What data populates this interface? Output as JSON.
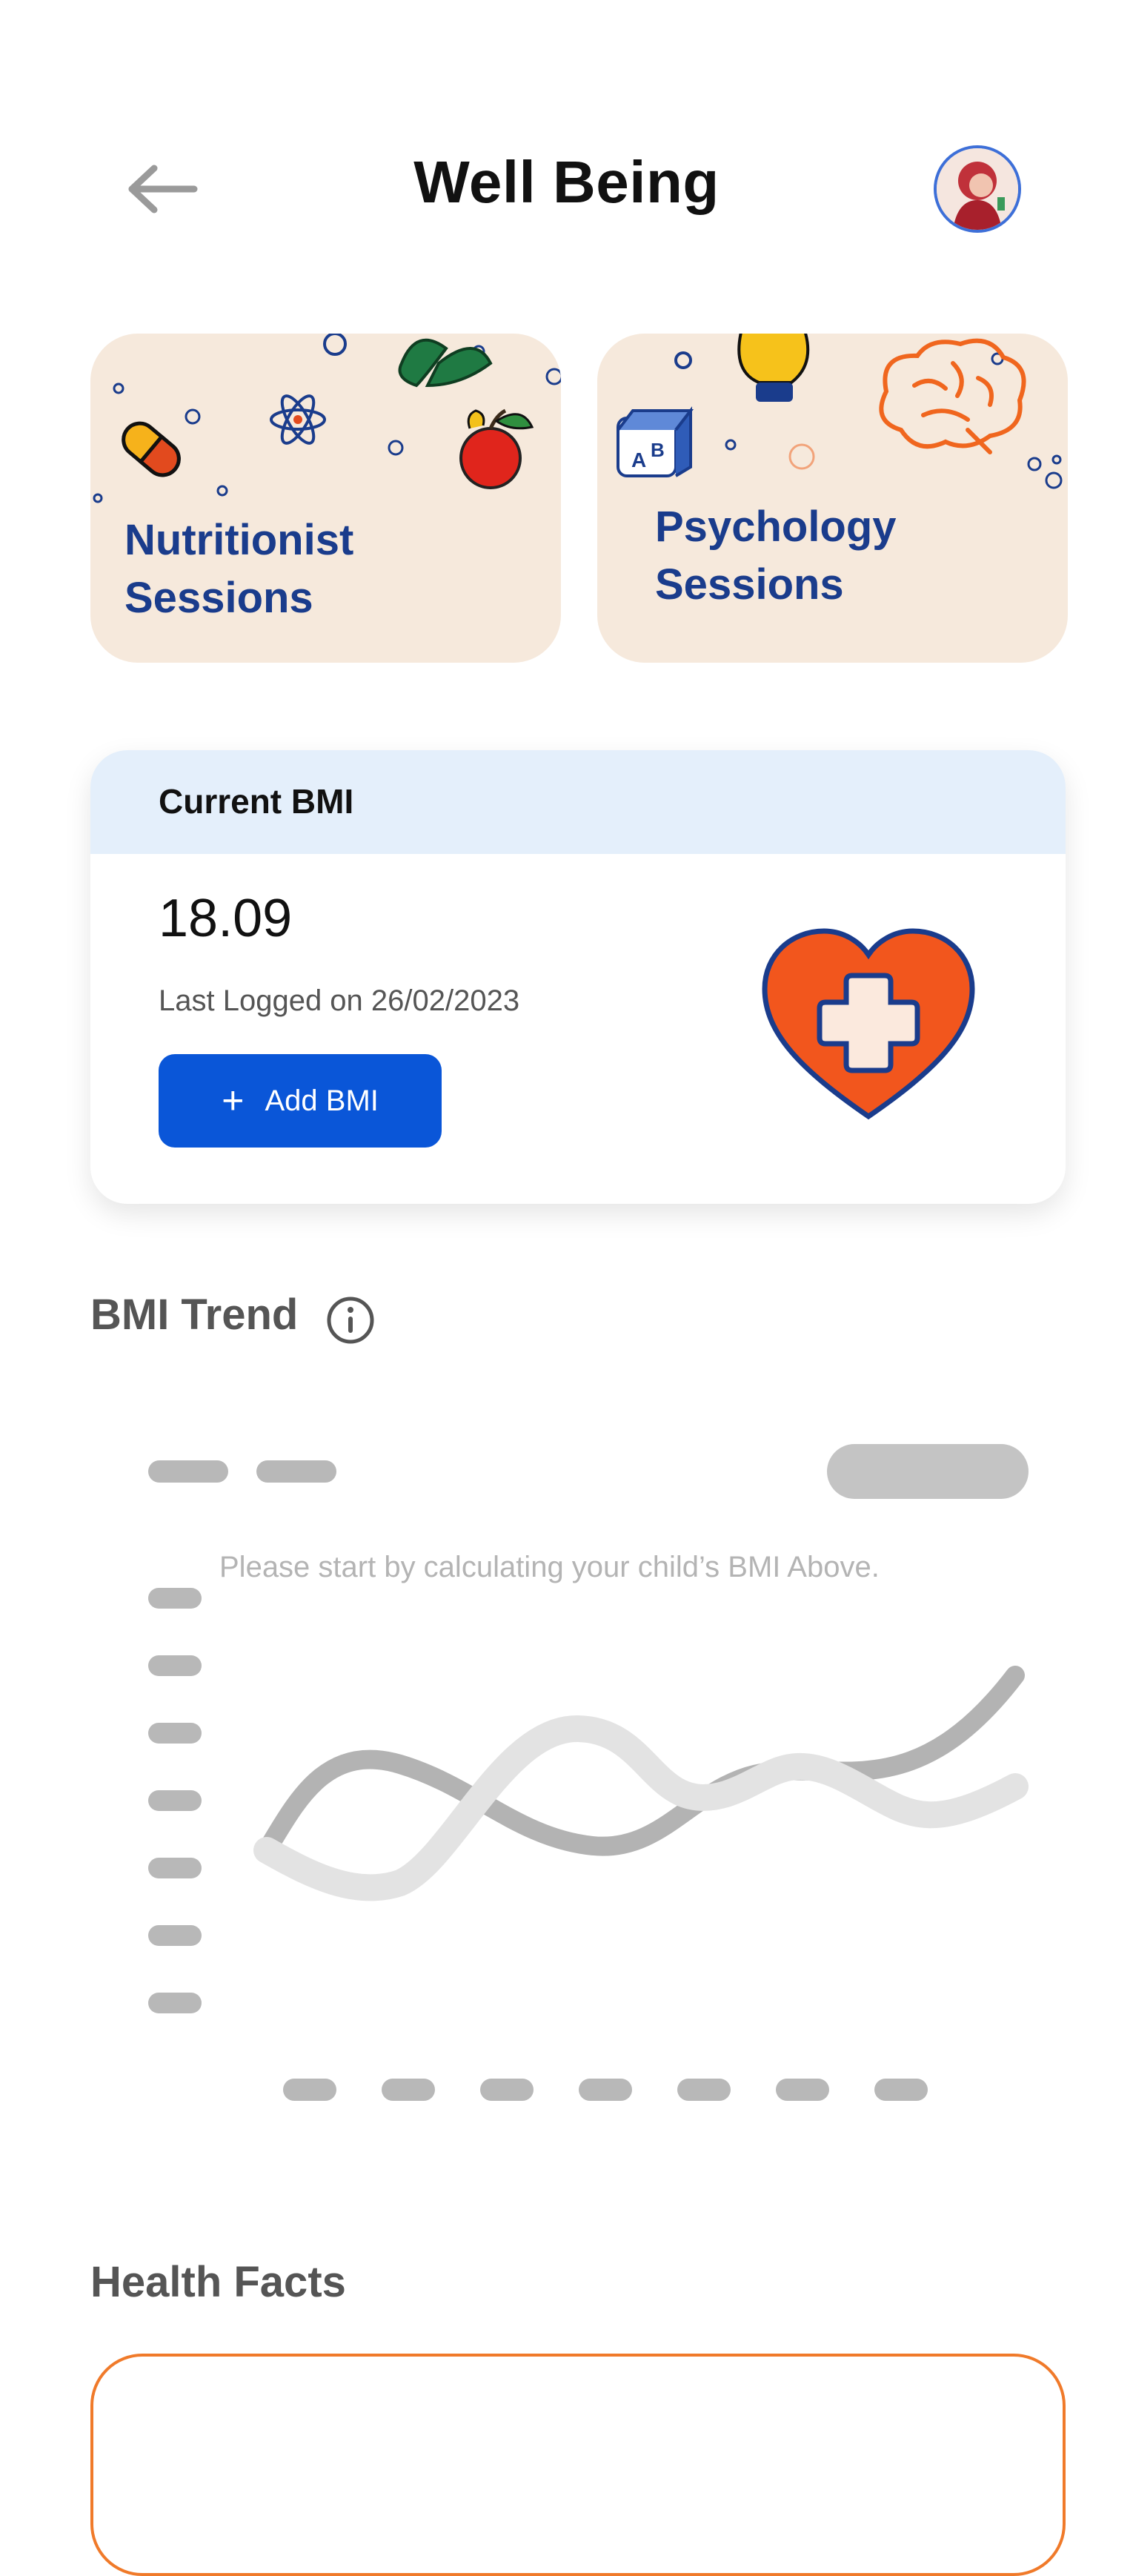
{
  "header": {
    "title": "Well Being",
    "back_icon": "arrow-left-icon",
    "avatar_icon": "profile-avatar"
  },
  "sessions": [
    {
      "label_line1": "Nutritionist",
      "label_line2": "Sessions",
      "illustration": "fruit-pill-atom-doodles"
    },
    {
      "label_line1": "Psychology",
      "label_line2": "Sessions",
      "illustration": "brain-bulb-blocks-doodles"
    }
  ],
  "bmi_card": {
    "header_label": "Current BMI",
    "value": "18.09",
    "last_logged": "Last Logged on 26/02/2023",
    "add_button": "Add BMI",
    "add_icon": "plus-icon",
    "heart_icon": "heart-medical-cross-icon"
  },
  "trend": {
    "title": "BMI Trend",
    "info_icon": "info-icon",
    "empty_message": "Please start by calculating your child’s BMI Above."
  },
  "facts": {
    "title": "Health Facts"
  },
  "colors": {
    "brand_blue": "#0a56d8",
    "label_navy": "#1a3c8c",
    "card_beige": "#f6e9dc",
    "bmi_header_bg": "#e4effb",
    "accent_orange": "#f07a2a",
    "heart_orange": "#f2561d"
  }
}
